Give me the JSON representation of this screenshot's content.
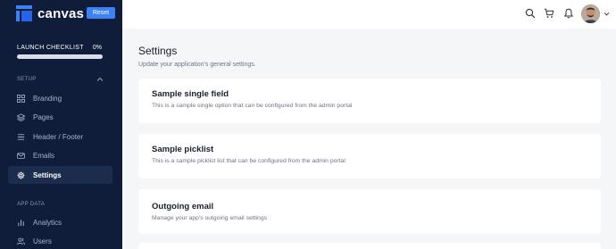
{
  "brand": {
    "name": "canvas",
    "reset_label": "Reset",
    "accent": "#3b82f6"
  },
  "launch_checklist": {
    "title": "LAUNCH CHECKLIST",
    "percent_label": "0%",
    "progress": 0
  },
  "sidebar": {
    "setup_label": "SETUP",
    "setup_items": [
      {
        "label": "Branding",
        "icon": "grid-icon"
      },
      {
        "label": "Pages",
        "icon": "layers-icon"
      },
      {
        "label": "Header / Footer",
        "icon": "menu-icon"
      },
      {
        "label": "Emails",
        "icon": "mail-icon"
      },
      {
        "label": "Settings",
        "icon": "gear-icon",
        "active": true
      }
    ],
    "app_data_label": "APP DATA",
    "app_data_items": [
      {
        "label": "Analytics",
        "icon": "bar-chart-icon"
      },
      {
        "label": "Users",
        "icon": "users-icon"
      }
    ]
  },
  "topbar": {
    "icons": [
      "search-icon",
      "cart-icon",
      "bell-icon"
    ],
    "avatar": "user-avatar"
  },
  "main": {
    "title": "Settings",
    "subtitle": "Update your application's general settings.",
    "cards": [
      {
        "title": "Sample single field",
        "description": "This is a sample single option that can be configured from the admin portal"
      },
      {
        "title": "Sample picklist",
        "description": "This is a sample picklist list that can be configured from the admin portal"
      },
      {
        "title": "Outgoing email",
        "description": "Manage your app's outgoing email settings"
      }
    ]
  }
}
